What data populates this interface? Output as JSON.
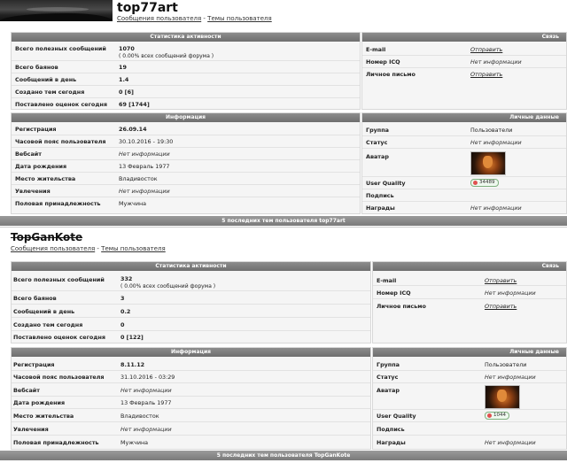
{
  "profiles": [
    {
      "username": "top77art",
      "links": {
        "messages": "Сообщения пользователя",
        "sep": " - ",
        "topics": "Темы пользователя"
      },
      "stats": {
        "header": "Статистика активности",
        "rows": [
          {
            "label": "Всего полезных сообщений",
            "value": "1070",
            "sub": "( 0.00% всех сообщений форума )"
          },
          {
            "label": "Всего баянов",
            "value": "19"
          },
          {
            "label": "Сообщений в день",
            "value": "1.4"
          },
          {
            "label": "Создано тем сегодня",
            "value": "0 [6]"
          },
          {
            "label": "Поставлено оценок сегодня",
            "value": "69 [1744]"
          }
        ]
      },
      "contact": {
        "header": "Связь",
        "rows": [
          {
            "label": "E-mail",
            "value": "Отправить"
          },
          {
            "label": "Номер ICQ",
            "value": "Нет информации"
          },
          {
            "label": "Личное письмо",
            "value": "Отправить"
          }
        ]
      },
      "info": {
        "header": "Информация",
        "rows": [
          {
            "label": "Регистрация",
            "value": "26.09.14"
          },
          {
            "label": "Часовой пояс пользователя",
            "value": "30.10.2016 - 19:30"
          },
          {
            "label": "Вебсайт",
            "value": "Нет информации"
          },
          {
            "label": "Дата рождения",
            "value": "13 Февраль 1977"
          },
          {
            "label": "Место жительства",
            "value": "Владивосток"
          },
          {
            "label": "Увлечения",
            "value": "Нет информации"
          },
          {
            "label": "Половая принадлежность",
            "value": "Мужчина"
          }
        ]
      },
      "personal": {
        "header": "Личные данные",
        "rows": [
          {
            "label": "Группа",
            "value": "Пользователи"
          },
          {
            "label": "Статус",
            "value": "Нет информации"
          },
          {
            "label": "Аватар",
            "value": ""
          },
          {
            "label": "User Quality",
            "value": "34489"
          },
          {
            "label": "Подпись",
            "value": ""
          },
          {
            "label": "Награды",
            "value": "Нет информации"
          }
        ]
      },
      "footer": "5 последних тем пользователя top77art"
    },
    {
      "username": "TopGanKote",
      "links": {
        "messages": "Сообщения пользователя",
        "sep": " - ",
        "topics": "Темы пользователя"
      },
      "stats": {
        "header": "Статистика активности",
        "rows": [
          {
            "label": "Всего полезных сообщений",
            "value": "332",
            "sub": "( 0.00% всех сообщений форума )"
          },
          {
            "label": "Всего баянов",
            "value": "3"
          },
          {
            "label": "Сообщений в день",
            "value": "0.2"
          },
          {
            "label": "Создано тем сегодня",
            "value": "0"
          },
          {
            "label": "Поставлено оценок сегодня",
            "value": "0 [122]"
          }
        ]
      },
      "contact": {
        "header": "Связь",
        "rows": [
          {
            "label": "E-mail",
            "value": "Отправить"
          },
          {
            "label": "Номер ICQ",
            "value": "Нет информации"
          },
          {
            "label": "Личное письмо",
            "value": "Отправить"
          }
        ]
      },
      "info": {
        "header": "Информация",
        "rows": [
          {
            "label": "Регистрация",
            "value": "8.11.12"
          },
          {
            "label": "Часовой пояс пользователя",
            "value": "31.10.2016 - 03:29"
          },
          {
            "label": "Вебсайт",
            "value": "Нет информации"
          },
          {
            "label": "Дата рождения",
            "value": "13 Февраль 1977"
          },
          {
            "label": "Место жительства",
            "value": "Владивосток"
          },
          {
            "label": "Увлечения",
            "value": "Нет информации"
          },
          {
            "label": "Половая принадлежность",
            "value": "Мужчина"
          }
        ]
      },
      "personal": {
        "header": "Личные данные",
        "rows": [
          {
            "label": "Группа",
            "value": "Пользователи"
          },
          {
            "label": "Статус",
            "value": "Нет информации"
          },
          {
            "label": "Аватар",
            "value": ""
          },
          {
            "label": "User Quality",
            "value": "1044"
          },
          {
            "label": "Подпись",
            "value": ""
          },
          {
            "label": "Награды",
            "value": "Нет информации"
          }
        ]
      },
      "footer": "5 последних тем пользователя TopGanKote"
    }
  ],
  "colors": {
    "header_bg": "#7d7d7d",
    "panel_bg": "#f5f5f5",
    "quality_badge": "#e05050"
  }
}
